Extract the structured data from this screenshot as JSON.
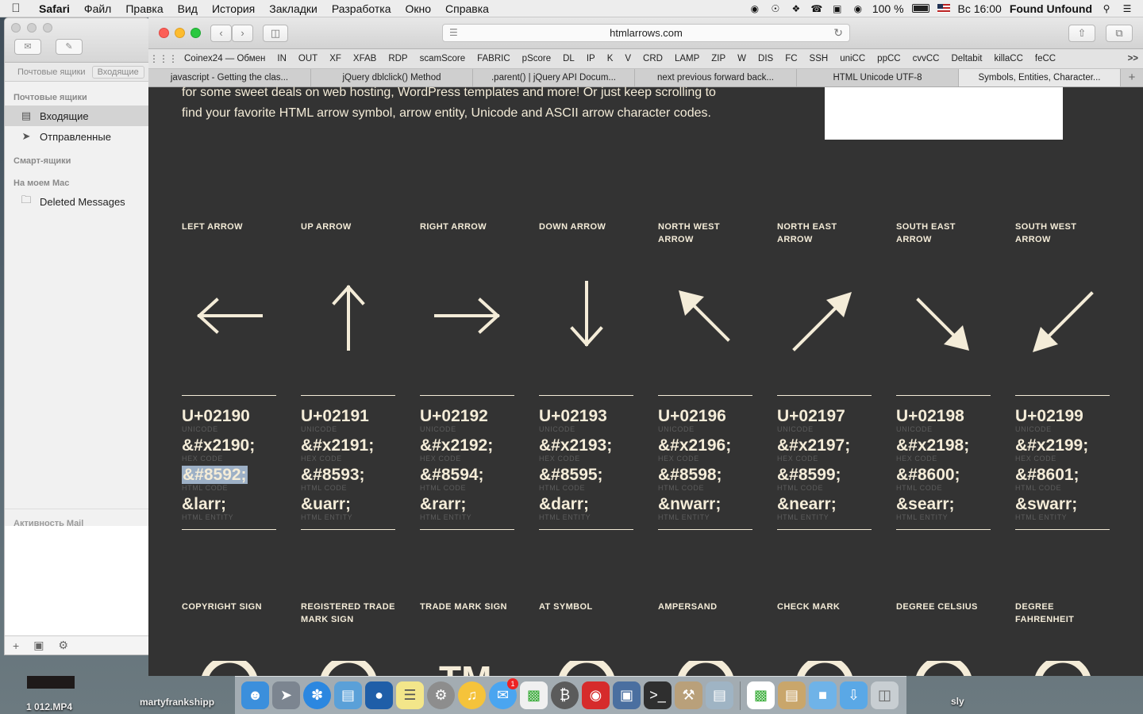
{
  "menubar": {
    "app": "Safari",
    "items": [
      "Файл",
      "Правка",
      "Вид",
      "История",
      "Закладки",
      "Разработка",
      "Окно",
      "Справка"
    ],
    "battery": "100 %",
    "clock": "Вс 16:00",
    "user": "Found Unfound"
  },
  "mail": {
    "fav_bar": {
      "mailboxes": "Почтовые ящики",
      "inbox_chip": "Входящие"
    },
    "sections": {
      "mailboxes": "Почтовые ящики",
      "smart": "Смарт-ящики",
      "on_mac": "На моем Mac",
      "activity": "Активность Mail"
    },
    "items": {
      "inbox": "Входящие",
      "sent": "Отправленные",
      "deleted": "Deleted Messages"
    }
  },
  "safari": {
    "url": "htmlarrows.com",
    "bookmarks": [
      "Coinex24 — Обмен",
      "IN",
      "OUT",
      "XF",
      "XFAB",
      "RDP",
      "scamScore",
      "FABRIC",
      "pScore",
      "DL",
      "IP",
      "K",
      "V",
      "CRD",
      "LAMP",
      "ZIP",
      "W",
      "DIS",
      "FC",
      "SSH",
      "uniCC",
      "ppCC",
      "cvvCC",
      "Deltabit",
      "killaCC",
      "feCC"
    ],
    "bookmarks_more": ">>",
    "tabs": [
      "javascript - Getting the clas...",
      "jQuery dblclick() Method",
      ".parent() | jQuery API Docum...",
      "next previous forward back...",
      "HTML Unicode UTF-8",
      "Symbols, Entities, Character..."
    ],
    "tab_add": "+"
  },
  "page": {
    "intro_line1": "for some sweet deals on web hosting, WordPress templates and more! Or just keep scrolling to",
    "intro_line2": "find your favorite HTML arrow symbol, arrow entity, Unicode and ASCII arrow character codes.",
    "labels": {
      "unicode": "UNICODE",
      "hex": "HEX CODE",
      "html": "HTML CODE",
      "entity": "HTML ENTITY"
    },
    "arrows": [
      {
        "title": "LEFT ARROW",
        "unicode": "U+02190",
        "hex": "&#x2190;",
        "html": "&#8592;",
        "entity": "&larr;",
        "icon": "left-arrow"
      },
      {
        "title": "UP ARROW",
        "unicode": "U+02191",
        "hex": "&#x2191;",
        "html": "&#8593;",
        "entity": "&uarr;",
        "icon": "up-arrow"
      },
      {
        "title": "RIGHT ARROW",
        "unicode": "U+02192",
        "hex": "&#x2192;",
        "html": "&#8594;",
        "entity": "&rarr;",
        "icon": "right-arrow"
      },
      {
        "title": "DOWN ARROW",
        "unicode": "U+02193",
        "hex": "&#x2193;",
        "html": "&#8595;",
        "entity": "&darr;",
        "icon": "down-arrow"
      },
      {
        "title": "NORTH WEST ARROW",
        "unicode": "U+02196",
        "hex": "&#x2196;",
        "html": "&#8598;",
        "entity": "&nwarr;",
        "icon": "north-west-arrow"
      },
      {
        "title": "NORTH EAST ARROW",
        "unicode": "U+02197",
        "hex": "&#x2197;",
        "html": "&#8599;",
        "entity": "&nearr;",
        "icon": "north-east-arrow"
      },
      {
        "title": "SOUTH EAST ARROW",
        "unicode": "U+02198",
        "hex": "&#x2198;",
        "html": "&#8600;",
        "entity": "&searr;",
        "icon": "south-east-arrow"
      },
      {
        "title": "SOUTH WEST ARROW",
        "unicode": "U+02199",
        "hex": "&#x2199;",
        "html": "&#8601;",
        "entity": "&swarr;",
        "icon": "south-west-arrow"
      }
    ],
    "symbols": [
      {
        "title": "COPYRIGHT SIGN"
      },
      {
        "title": "REGISTERED TRADE MARK SIGN"
      },
      {
        "title": "TRADE MARK SIGN",
        "glyph": "TM"
      },
      {
        "title": "AT SYMBOL"
      },
      {
        "title": "AMPERSAND"
      },
      {
        "title": "CHECK MARK"
      },
      {
        "title": "DEGREE CELSIUS"
      },
      {
        "title": "DEGREE FAHRENHEIT"
      }
    ]
  },
  "desktop": {
    "file1": "1 012.MP4",
    "file2": "martyfrankshipp",
    "file3": "sly"
  },
  "dock": {
    "icons": [
      "finder-icon",
      "launchpad-icon",
      "safari-icon",
      "preview-icon",
      "adium-icon",
      "notes-icon",
      "system-preferences-icon",
      "itunes-icon",
      "messages-icon",
      "numbers-icon",
      "bitcoin-icon",
      "photo-booth-icon",
      "virtualbox-icon",
      "terminal-icon",
      "utilities-icon",
      "image-capture-icon",
      "numbers-doc-icon",
      "archive-icon",
      "folder-icon",
      "downloads-icon",
      "trash-icon"
    ],
    "messages_badge": "1"
  }
}
